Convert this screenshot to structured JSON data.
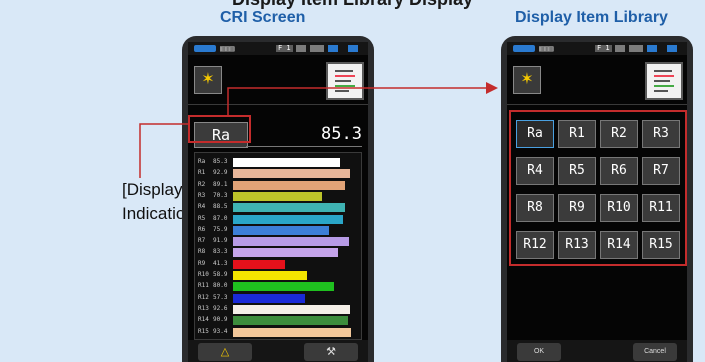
{
  "header_clipped": "Display Item Library Display",
  "titles": {
    "left": "CRI Screen",
    "right": "Display Item Library"
  },
  "callout": {
    "line1": "[Display Item]",
    "line2": "Indication"
  },
  "cri": {
    "status": {
      "signal": "▥▥▥",
      "channel": "F 1"
    },
    "icon": "✶",
    "item_label": "Ra",
    "item_value": "85.3",
    "bars": [
      {
        "label": "Ra",
        "value": "85.3",
        "pct": 85.3,
        "color": "#ffffff"
      },
      {
        "label": "R1",
        "value": "92.9",
        "pct": 92.9,
        "color": "#e8b79a"
      },
      {
        "label": "R2",
        "value": "89.1",
        "pct": 89.1,
        "color": "#e1a377"
      },
      {
        "label": "R3",
        "value": "70.3",
        "pct": 70.3,
        "color": "#bcc42a"
      },
      {
        "label": "R4",
        "value": "88.5",
        "pct": 88.5,
        "color": "#3fb3b3"
      },
      {
        "label": "R5",
        "value": "87.0",
        "pct": 87.0,
        "color": "#2aa6c8"
      },
      {
        "label": "R6",
        "value": "75.9",
        "pct": 75.9,
        "color": "#3c7fd8"
      },
      {
        "label": "R7",
        "value": "91.9",
        "pct": 91.9,
        "color": "#b79be6"
      },
      {
        "label": "R8",
        "value": "83.3",
        "pct": 83.3,
        "color": "#c5a4ea"
      },
      {
        "label": "R9",
        "value": "41.3",
        "pct": 41.3,
        "color": "#e6111b"
      },
      {
        "label": "R10",
        "value": "58.9",
        "pct": 58.9,
        "color": "#f3e600"
      },
      {
        "label": "R11",
        "value": "80.0",
        "pct": 80.0,
        "color": "#1fc01f"
      },
      {
        "label": "R12",
        "value": "57.3",
        "pct": 57.3,
        "color": "#1a2ad8"
      },
      {
        "label": "R13",
        "value": "92.6",
        "pct": 92.6,
        "color": "#f4efe8"
      },
      {
        "label": "R14",
        "value": "90.9",
        "pct": 90.9,
        "color": "#3c8c3c"
      },
      {
        "label": "R15",
        "value": "93.4",
        "pct": 93.4,
        "color": "#f2c79a"
      }
    ],
    "bottom": {
      "left_icon": "△",
      "right_icon": "⚒"
    }
  },
  "library": {
    "status": {
      "signal": "▥▥▥",
      "channel": "F 1"
    },
    "icon": "✶",
    "items": [
      "Ra",
      "R1",
      "R2",
      "R3",
      "R4",
      "R5",
      "R6",
      "R7",
      "R8",
      "R9",
      "R10",
      "R11",
      "R12",
      "R13",
      "R14",
      "R15"
    ],
    "selected": "Ra",
    "ok_label": "OK",
    "cancel_label": "Cancel"
  },
  "colors": {
    "title": "#1f5fa8",
    "callout_line": "#c42c2c",
    "arrow": "#c42c2c"
  }
}
